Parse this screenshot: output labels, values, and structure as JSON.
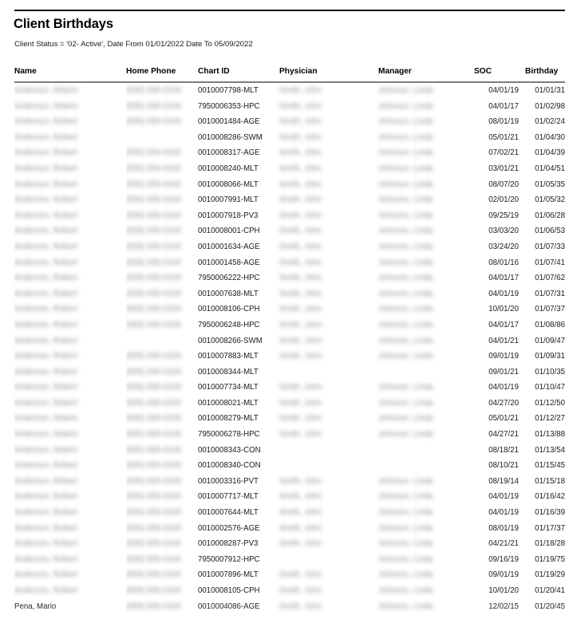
{
  "report": {
    "title": "Client Birthdays",
    "criteria": "Client Status  = '02- Active', Date From 01/01/2022 Date To 05/09/2022"
  },
  "table": {
    "columns": [
      {
        "key": "name",
        "label": "Name"
      },
      {
        "key": "phone",
        "label": "Home Phone"
      },
      {
        "key": "chart_id",
        "label": "Chart ID"
      },
      {
        "key": "physician",
        "label": "Physician"
      },
      {
        "key": "manager",
        "label": "Manager"
      },
      {
        "key": "soc",
        "label": "SOC"
      },
      {
        "key": "birthday",
        "label": "Birthday"
      }
    ],
    "rows": [
      {
        "name": "",
        "name_redacted": true,
        "phone": "",
        "phone_redacted": true,
        "chart_id": "0010007798-MLT",
        "physician": "",
        "physician_redacted": true,
        "manager": "",
        "manager_redacted": true,
        "soc": "04/01/19",
        "birthday": "01/01/31"
      },
      {
        "name": "",
        "name_redacted": true,
        "phone": "",
        "phone_redacted": true,
        "chart_id": "7950006353-HPC",
        "physician": "",
        "physician_redacted": true,
        "manager": "",
        "manager_redacted": true,
        "soc": "04/01/17",
        "birthday": "01/02/98"
      },
      {
        "name": "",
        "name_redacted": true,
        "phone": "",
        "phone_redacted": true,
        "chart_id": "0010001484-AGE",
        "physician": "",
        "physician_redacted": true,
        "manager": "",
        "manager_redacted": true,
        "soc": "08/01/19",
        "birthday": "01/02/24"
      },
      {
        "name": "",
        "name_redacted": true,
        "phone": "",
        "phone_redacted": false,
        "chart_id": "0010008286-SWM",
        "physician": "",
        "physician_redacted": true,
        "manager": "",
        "manager_redacted": true,
        "soc": "05/01/21",
        "birthday": "01/04/30"
      },
      {
        "name": "",
        "name_redacted": true,
        "phone": "",
        "phone_redacted": true,
        "chart_id": "0010008317-AGE",
        "physician": "",
        "physician_redacted": true,
        "manager": "",
        "manager_redacted": true,
        "soc": "07/02/21",
        "birthday": "01/04/39"
      },
      {
        "name": "",
        "name_redacted": true,
        "phone": "",
        "phone_redacted": true,
        "chart_id": "0010008240-MLT",
        "physician": "",
        "physician_redacted": true,
        "manager": "",
        "manager_redacted": true,
        "soc": "03/01/21",
        "birthday": "01/04/51"
      },
      {
        "name": "",
        "name_redacted": true,
        "phone": "",
        "phone_redacted": true,
        "chart_id": "0010008066-MLT",
        "physician": "",
        "physician_redacted": true,
        "manager": "",
        "manager_redacted": true,
        "soc": "08/07/20",
        "birthday": "01/05/35"
      },
      {
        "name": "",
        "name_redacted": true,
        "phone": "",
        "phone_redacted": true,
        "chart_id": "0010007991-MLT",
        "physician": "",
        "physician_redacted": true,
        "manager": "",
        "manager_redacted": true,
        "soc": "02/01/20",
        "birthday": "01/05/32"
      },
      {
        "name": "",
        "name_redacted": true,
        "phone": "",
        "phone_redacted": true,
        "chart_id": "0010007918-PV3",
        "physician": "",
        "physician_redacted": true,
        "manager": "",
        "manager_redacted": true,
        "soc": "09/25/19",
        "birthday": "01/06/28"
      },
      {
        "name": "",
        "name_redacted": true,
        "phone": "",
        "phone_redacted": true,
        "chart_id": "0010008001-CPH",
        "physician": "",
        "physician_redacted": true,
        "manager": "",
        "manager_redacted": true,
        "soc": "03/03/20",
        "birthday": "01/06/53"
      },
      {
        "name": "",
        "name_redacted": true,
        "phone": "",
        "phone_redacted": true,
        "chart_id": "0010001634-AGE",
        "physician": "",
        "physician_redacted": true,
        "manager": "",
        "manager_redacted": true,
        "soc": "03/24/20",
        "birthday": "01/07/33"
      },
      {
        "name": "",
        "name_redacted": true,
        "phone": "",
        "phone_redacted": true,
        "chart_id": "0010001458-AGE",
        "physician": "",
        "physician_redacted": true,
        "manager": "",
        "manager_redacted": true,
        "soc": "08/01/16",
        "birthday": "01/07/41"
      },
      {
        "name": "",
        "name_redacted": true,
        "phone": "",
        "phone_redacted": true,
        "chart_id": "7950006222-HPC",
        "physician": "",
        "physician_redacted": true,
        "manager": "",
        "manager_redacted": true,
        "soc": "04/01/17",
        "birthday": "01/07/62"
      },
      {
        "name": "",
        "name_redacted": true,
        "phone": "",
        "phone_redacted": true,
        "chart_id": "0010007638-MLT",
        "physician": "",
        "physician_redacted": true,
        "manager": "",
        "manager_redacted": true,
        "soc": "04/01/19",
        "birthday": "01/07/31"
      },
      {
        "name": "",
        "name_redacted": true,
        "phone": "",
        "phone_redacted": true,
        "chart_id": "0010008106-CPH",
        "physician": "",
        "physician_redacted": true,
        "manager": "",
        "manager_redacted": true,
        "soc": "10/01/20",
        "birthday": "01/07/37"
      },
      {
        "name": "",
        "name_redacted": true,
        "phone": "",
        "phone_redacted": true,
        "chart_id": "7950006248-HPC",
        "physician": "",
        "physician_redacted": true,
        "manager": "",
        "manager_redacted": true,
        "soc": "04/01/17",
        "birthday": "01/08/86"
      },
      {
        "name": "",
        "name_redacted": true,
        "phone": "",
        "phone_redacted": false,
        "chart_id": "0010008266-SWM",
        "physician": "",
        "physician_redacted": true,
        "manager": "",
        "manager_redacted": true,
        "soc": "04/01/21",
        "birthday": "01/09/47"
      },
      {
        "name": "",
        "name_redacted": true,
        "phone": "",
        "phone_redacted": true,
        "chart_id": "0010007883-MLT",
        "physician": "",
        "physician_redacted": true,
        "manager": "",
        "manager_redacted": true,
        "soc": "09/01/19",
        "birthday": "01/09/31"
      },
      {
        "name": "",
        "name_redacted": true,
        "phone": "",
        "phone_redacted": true,
        "chart_id": "0010008344-MLT",
        "physician": "",
        "physician_redacted": false,
        "manager": "",
        "manager_redacted": false,
        "soc": "09/01/21",
        "birthday": "01/10/35"
      },
      {
        "name": "",
        "name_redacted": true,
        "phone": "",
        "phone_redacted": true,
        "chart_id": "0010007734-MLT",
        "physician": "",
        "physician_redacted": true,
        "manager": "",
        "manager_redacted": true,
        "soc": "04/01/19",
        "birthday": "01/10/47"
      },
      {
        "name": "",
        "name_redacted": true,
        "phone": "",
        "phone_redacted": true,
        "chart_id": "0010008021-MLT",
        "physician": "",
        "physician_redacted": true,
        "manager": "",
        "manager_redacted": true,
        "soc": "04/27/20",
        "birthday": "01/12/50"
      },
      {
        "name": "",
        "name_redacted": true,
        "phone": "",
        "phone_redacted": true,
        "chart_id": "0010008279-MLT",
        "physician": "",
        "physician_redacted": true,
        "manager": "",
        "manager_redacted": true,
        "soc": "05/01/21",
        "birthday": "01/12/27"
      },
      {
        "name": "",
        "name_redacted": true,
        "phone": "",
        "phone_redacted": true,
        "chart_id": "7950006278-HPC",
        "physician": "",
        "physician_redacted": true,
        "manager": "",
        "manager_redacted": true,
        "soc": "04/27/21",
        "birthday": "01/13/88"
      },
      {
        "name": "",
        "name_redacted": true,
        "phone": "",
        "phone_redacted": true,
        "chart_id": "0010008343-CON",
        "physician": "",
        "physician_redacted": false,
        "manager": "",
        "manager_redacted": false,
        "soc": "08/18/21",
        "birthday": "01/13/54"
      },
      {
        "name": "",
        "name_redacted": true,
        "phone": "",
        "phone_redacted": true,
        "chart_id": "0010008340-CON",
        "physician": "",
        "physician_redacted": false,
        "manager": "",
        "manager_redacted": false,
        "soc": "08/10/21",
        "birthday": "01/15/45"
      },
      {
        "name": "",
        "name_redacted": true,
        "phone": "",
        "phone_redacted": true,
        "chart_id": "0010003316-PVT",
        "physician": "",
        "physician_redacted": true,
        "manager": "",
        "manager_redacted": true,
        "soc": "08/19/14",
        "birthday": "01/15/18"
      },
      {
        "name": "",
        "name_redacted": true,
        "phone": "",
        "phone_redacted": true,
        "chart_id": "0010007717-MLT",
        "physician": "",
        "physician_redacted": true,
        "manager": "",
        "manager_redacted": true,
        "soc": "04/01/19",
        "birthday": "01/16/42"
      },
      {
        "name": "",
        "name_redacted": true,
        "phone": "",
        "phone_redacted": true,
        "chart_id": "0010007644-MLT",
        "physician": "",
        "physician_redacted": true,
        "manager": "",
        "manager_redacted": true,
        "soc": "04/01/19",
        "birthday": "01/16/39"
      },
      {
        "name": "",
        "name_redacted": true,
        "phone": "",
        "phone_redacted": true,
        "chart_id": "0010002576-AGE",
        "physician": "",
        "physician_redacted": true,
        "manager": "",
        "manager_redacted": true,
        "soc": "08/01/19",
        "birthday": "01/17/37"
      },
      {
        "name": "",
        "name_redacted": true,
        "phone": "",
        "phone_redacted": true,
        "chart_id": "0010008287-PV3",
        "physician": "",
        "physician_redacted": true,
        "manager": "",
        "manager_redacted": true,
        "soc": "04/21/21",
        "birthday": "01/18/28"
      },
      {
        "name": "",
        "name_redacted": true,
        "phone": "",
        "phone_redacted": true,
        "chart_id": "7950007912-HPC",
        "physician": "",
        "physician_redacted": false,
        "manager": "",
        "manager_redacted": true,
        "soc": "09/16/19",
        "birthday": "01/19/75"
      },
      {
        "name": "",
        "name_redacted": true,
        "phone": "",
        "phone_redacted": true,
        "chart_id": "0010007896-MLT",
        "physician": "",
        "physician_redacted": true,
        "manager": "",
        "manager_redacted": true,
        "soc": "09/01/19",
        "birthday": "01/19/29"
      },
      {
        "name": "",
        "name_redacted": true,
        "phone": "",
        "phone_redacted": true,
        "chart_id": "0010008105-CPH",
        "physician": "",
        "physician_redacted": true,
        "manager": "",
        "manager_redacted": true,
        "soc": "10/01/20",
        "birthday": "01/20/41"
      },
      {
        "name": "Pena, Mario",
        "name_redacted": false,
        "phone": "",
        "phone_redacted": true,
        "chart_id": "0010004086-AGE",
        "physician": "",
        "physician_redacted": true,
        "manager": "",
        "manager_redacted": true,
        "soc": "12/02/15",
        "birthday": "01/20/45"
      }
    ]
  }
}
